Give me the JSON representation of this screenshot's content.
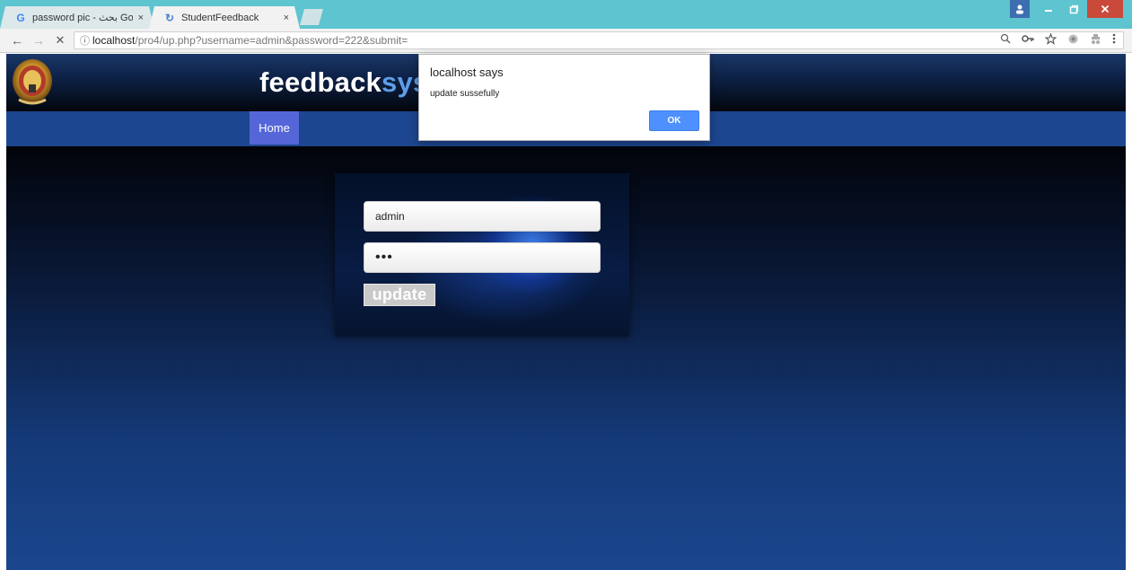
{
  "browser": {
    "tabs": [
      {
        "title": "password pic - بحث Goo",
        "favicon": "G",
        "favicon_name": "google-icon",
        "active": false
      },
      {
        "title": "StudentFeedback",
        "favicon": "↻",
        "favicon_name": "loading-icon",
        "active": true
      }
    ],
    "tab_close_glyph": "×",
    "url": {
      "host": "localhost",
      "path": "/pro4/up.php?username=admin&password=222&submit="
    },
    "nav_icons": {
      "back": "←",
      "forward": "→",
      "stop": "✕",
      "info": "ⓘ"
    },
    "omnibox_icons": [
      "zoom-icon",
      "key-icon",
      "star-icon",
      "extension-icon",
      "incognito-icon",
      "menu-icon"
    ]
  },
  "page": {
    "title_main": "feedback",
    "title_accent": "sys",
    "nav": {
      "home_label": "Home"
    },
    "form": {
      "username_value": "admin",
      "password_value": "•••",
      "submit_label": "update"
    }
  },
  "dialog": {
    "title": "localhost says",
    "message": "update sussefully",
    "ok_label": "OK"
  },
  "colors": {
    "tabbar": "#5ec4cf",
    "navbar": "#1d4690",
    "nav_home": "#5566d8",
    "title_accent": "#5d9ee8",
    "ok_button": "#4d90fe"
  }
}
